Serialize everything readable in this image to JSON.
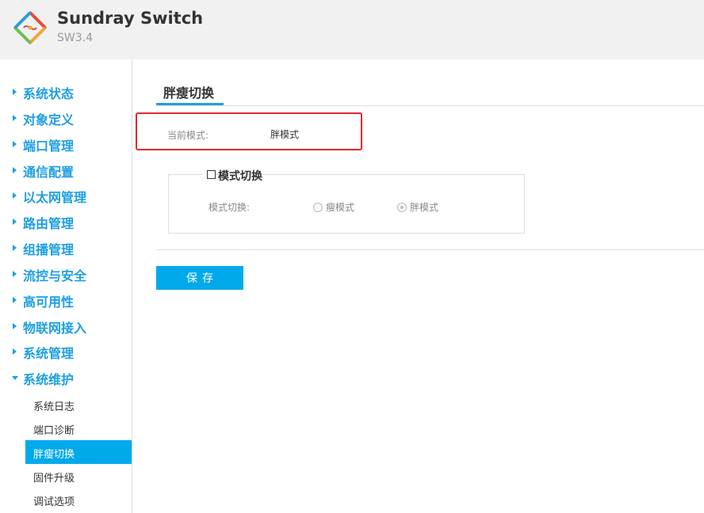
{
  "header": {
    "title": "Sundray Switch",
    "version": "SW3.4",
    "logo_icon": "sundray-logo-icon"
  },
  "sidebar": {
    "menu": [
      {
        "label": "系统状态",
        "expanded": false
      },
      {
        "label": "对象定义",
        "expanded": false
      },
      {
        "label": "端口管理",
        "expanded": false
      },
      {
        "label": "通信配置",
        "expanded": false
      },
      {
        "label": "以太网管理",
        "expanded": false
      },
      {
        "label": "路由管理",
        "expanded": false
      },
      {
        "label": "组播管理",
        "expanded": false
      },
      {
        "label": "流控与安全",
        "expanded": false
      },
      {
        "label": "高可用性",
        "expanded": false
      },
      {
        "label": "物联网接入",
        "expanded": false
      },
      {
        "label": "系统管理",
        "expanded": false
      },
      {
        "label": "系统维护",
        "expanded": true
      }
    ],
    "submenu": [
      {
        "label": "系统日志",
        "active": false
      },
      {
        "label": "端口诊断",
        "active": false
      },
      {
        "label": "胖瘦切换",
        "active": true
      },
      {
        "label": "固件升级",
        "active": false
      },
      {
        "label": "调试选项",
        "active": false
      }
    ]
  },
  "main": {
    "tab_title": "胖瘦切换",
    "current_mode_label": "当前模式:",
    "current_mode_value": "胖模式",
    "mode_switch": {
      "legend": "模式切换",
      "checked": false,
      "field_label": "模式切换:",
      "options": [
        {
          "label": "瘦模式",
          "selected": false
        },
        {
          "label": "胖模式",
          "selected": true
        }
      ]
    },
    "save_label": "保存"
  },
  "colors": {
    "accent": "#1e9fe0",
    "active_bg": "#00aaea",
    "highlight_border": "#e4272c"
  }
}
